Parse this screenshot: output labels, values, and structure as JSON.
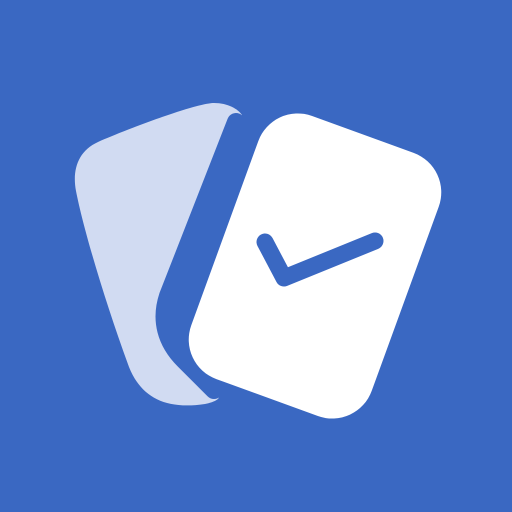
{
  "icon": {
    "name": "flashcards-check-app-icon",
    "colors": {
      "background": "#3A68C2",
      "back_card": "#D1DBF2",
      "front_card": "#FFFFFF",
      "checkmark": "#3A68C2"
    },
    "elements": [
      "background",
      "back-card",
      "front-card",
      "checkmark-icon"
    ]
  }
}
